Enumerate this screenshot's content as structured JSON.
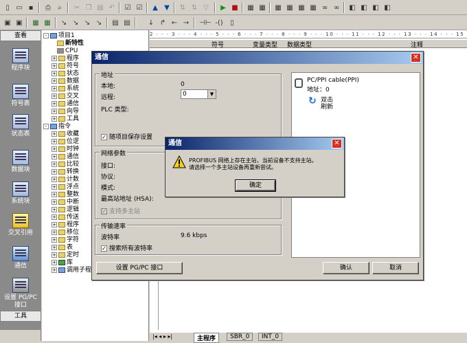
{
  "nav": {
    "header": "查看",
    "footer": "工具",
    "items": [
      "程序块",
      "符号表",
      "状态表",
      "数据块",
      "系统块",
      "交叉引用",
      "通信",
      "设置 PG/PC 接口"
    ]
  },
  "tree": {
    "project": "项目1",
    "nodes": [
      "新特性",
      "CPU",
      "程序",
      "符号",
      "状态",
      "数据",
      "系统",
      "交叉",
      "通信",
      "向导",
      "工具"
    ],
    "instructions": "指令",
    "instr_nodes": [
      "收藏",
      "位逻",
      "时钟",
      "通信",
      "比较",
      "转换",
      "计数",
      "浮点",
      "整数",
      "中断",
      "逻辑",
      "传送",
      "程序",
      "移位",
      "字符",
      "表",
      "定时",
      "库",
      "调用子程序"
    ]
  },
  "editor": {
    "ruler": "2 · · · 3 · · · 4 · · · 5 · · · 6 · · · 7 · · · 8 · · · 9 · · · 10 · · · 11 · · · 12 · · · 13 · · · 14 · · · 15 · · · 16 · · · 17 · · · 18",
    "columns": [
      "符号",
      "变量类型",
      "数据类型",
      "注释"
    ],
    "tabs": [
      "主程序",
      "SBR_0",
      "INT_0"
    ]
  },
  "comm_dialog": {
    "title": "通信",
    "address_group": "地址",
    "local_label": "本地:",
    "local_value": "0",
    "remote_label": "远程:",
    "remote_value": "0",
    "plc_type_label": "PLC 类型:",
    "save_with_project": "随项目保存设置",
    "network_group": "网络参数",
    "interface_label": "接口:",
    "protocol_label": "协议:",
    "mode_label": "模式:",
    "hsa_label": "最高站地址 (HSA):",
    "multi_master": "支持多主站",
    "rate_group": "传输速率",
    "baud_label": "波特率",
    "baud_value": "9.6 kbps",
    "search_all": "搜索所有波特率",
    "set_pgpc_button": "设置 PG/PC 接口",
    "ok_button": "确认",
    "cancel_button": "取消",
    "cable_name": "PC/PPI cable(PPI)",
    "cable_addr": "地址：0",
    "refresh_line1": "双击",
    "refresh_line2": "刷新"
  },
  "alert": {
    "title": "通信",
    "message_line1": "PROFIBUS 网络上存在主站，当前设备不支持主站。",
    "message_line2": "请选择一个多主站设备再重新尝试。",
    "ok_button": "确定"
  }
}
